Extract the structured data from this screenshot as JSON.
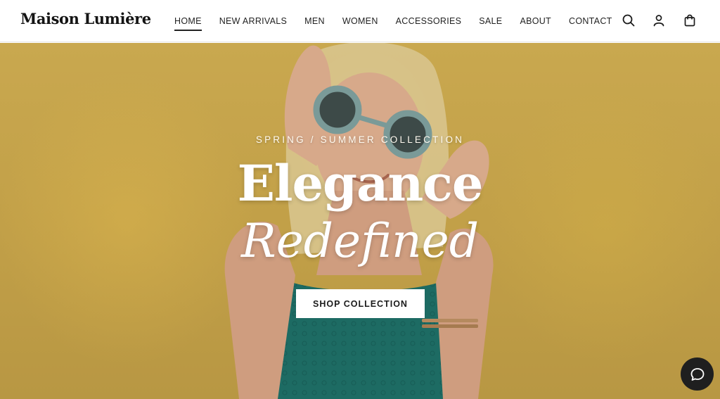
{
  "brand": {
    "name": "Maison Lumière"
  },
  "nav": {
    "items": [
      {
        "label": "HOME",
        "active": true
      },
      {
        "label": "NEW ARRIVALS",
        "active": false
      },
      {
        "label": "MEN",
        "active": false
      },
      {
        "label": "WOMEN",
        "active": false
      },
      {
        "label": "ACCESSORIES",
        "active": false
      },
      {
        "label": "SALE",
        "active": false
      },
      {
        "label": "ABOUT",
        "active": false
      },
      {
        "label": "CONTACT",
        "active": false
      }
    ]
  },
  "header_icons": [
    "search-icon",
    "account-icon",
    "cart-icon"
  ],
  "hero": {
    "subtitle": "SPRING / SUMMER COLLECTION",
    "title_line1": "Elegance",
    "title_line2": "Redefined",
    "cta_label": "SHOP COLLECTION"
  },
  "chat": {
    "icon": "chat-bubble-icon"
  },
  "colors": {
    "hero_background": "#c2a048",
    "dress": "#1d6b63",
    "chat_button": "#1f1f1f",
    "text_dark": "#1b1b1b"
  }
}
